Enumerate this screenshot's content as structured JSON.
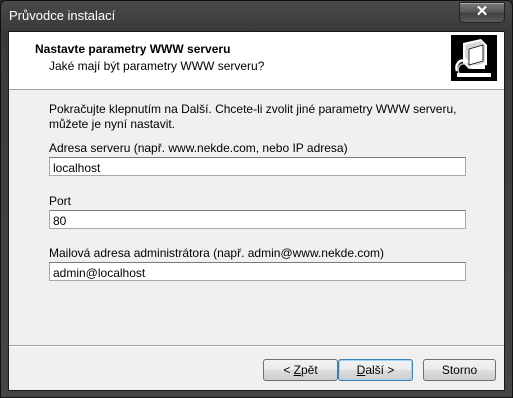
{
  "window": {
    "title": "Průvodce instalací",
    "close_glyph": "✕"
  },
  "header": {
    "title": "Nastavte parametry WWW serveru",
    "subtitle": "Jaké mají být parametry WWW serveru?",
    "icon": "server-wizard-icon"
  },
  "intro": "Pokračujte klepnutím na Další. Chcete-li zvolit jiné parametry WWW serveru, můžete je nyní nastavit.",
  "fields": {
    "server_address": {
      "label": "Adresa serveru (např. www.nekde.com, nebo IP adresa)",
      "value": "localhost"
    },
    "port": {
      "label": "Port",
      "value": "80"
    },
    "admin_email": {
      "label": "Mailová adresa administrátora (např. admin@www.nekde.com)",
      "value": "admin@localhost"
    }
  },
  "buttons": {
    "back": {
      "prefix": "< ",
      "mnemonic": "Z",
      "rest": "pět"
    },
    "next": {
      "mnemonic": "D",
      "rest": "alší >"
    },
    "cancel": "Storno"
  }
}
